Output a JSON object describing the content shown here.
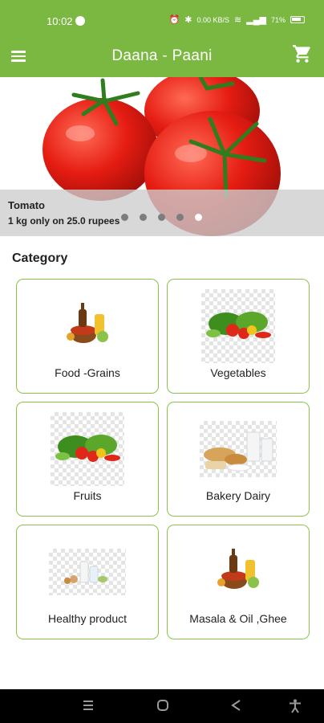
{
  "status": {
    "time": "10:02",
    "data_speed": "0.00 KB/S",
    "battery": "71%"
  },
  "app_bar": {
    "title": "Daana - Paani"
  },
  "banner": {
    "title": "Tomato",
    "subtitle": "1 kg only on 25.0 rupees",
    "slides": 5,
    "active_slide": 5
  },
  "category": {
    "heading": "Category",
    "items": [
      {
        "label": "Food -Grains"
      },
      {
        "label": "Vegetables"
      },
      {
        "label": "Fruits"
      },
      {
        "label": "Bakery Dairy"
      },
      {
        "label": "Healthy product"
      },
      {
        "label": "Masala & Oil ,Ghee"
      }
    ]
  },
  "theme": {
    "primary": "#7bb842",
    "card_border": "#8bc34a"
  }
}
